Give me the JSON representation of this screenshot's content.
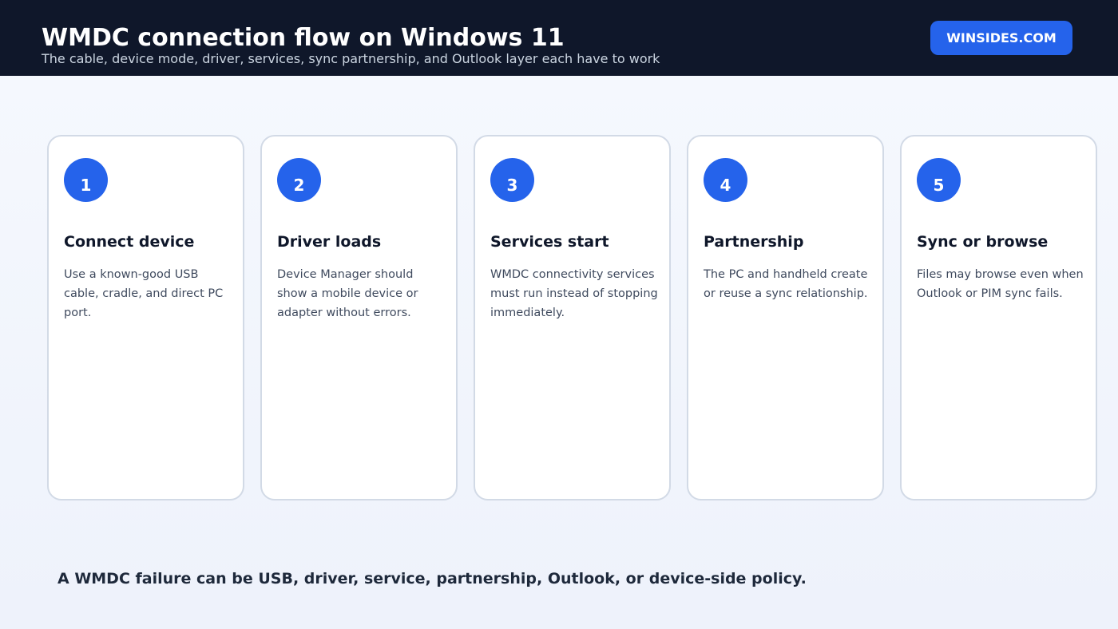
{
  "header": {
    "title": "WMDC connection flow on Windows 11",
    "subtitle": "The cable, device mode, driver, services, sync partnership, and Outlook layer each have to work",
    "brand": "WINSIDES.COM"
  },
  "steps": [
    {
      "number": "1",
      "title": "Connect device",
      "description": "Use a known-good USB cable, cradle, and direct PC port."
    },
    {
      "number": "2",
      "title": "Driver loads",
      "description": "Device Manager should show a mobile device or adapter without errors."
    },
    {
      "number": "3",
      "title": "Services start",
      "description": "WMDC connectivity services must run instead of stopping immediately."
    },
    {
      "number": "4",
      "title": "Partnership",
      "description": "The PC and handheld create or reuse a sync relationship."
    },
    {
      "number": "5",
      "title": "Sync or browse",
      "description": "Files may browse even when Outlook or PIM sync fails."
    }
  ],
  "footer": {
    "note": "A WMDC failure can be USB, driver, service, partnership, Outlook, or device-side policy."
  },
  "colors": {
    "header_bg": "#0f172a",
    "accent": "#2563eb",
    "card_border": "#d2dae6"
  }
}
